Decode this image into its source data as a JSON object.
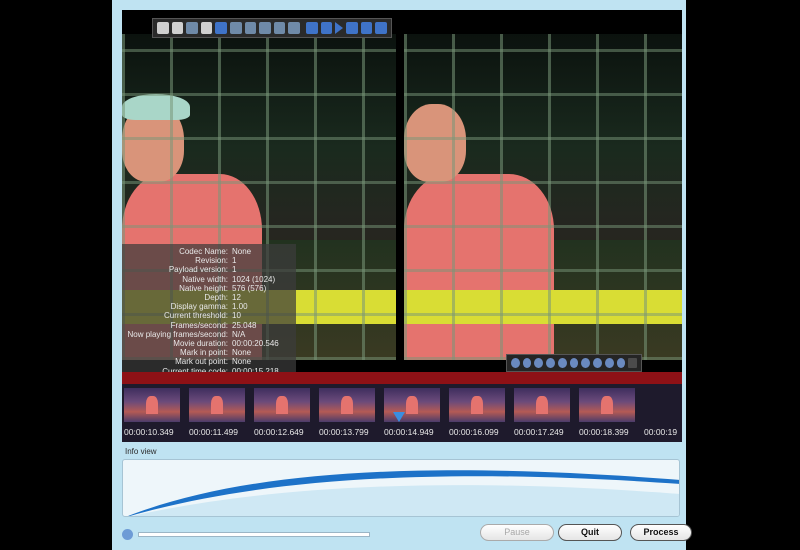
{
  "colors": {
    "window_bg": "#bfe3f2",
    "timeline_red": "#8e1116",
    "playhead": "#3a8ee0",
    "net_yellow_bar": "#d9dd34"
  },
  "player_toolbar": {
    "icons": [
      "folder-icon",
      "frame-icon",
      "split-icon",
      "compare-icon",
      "refresh-icon",
      "zoom-in-icon",
      "zoom-out-icon",
      "move-icon",
      "fit-icon",
      "monitor-icon",
      "skip-start-icon",
      "step-back-icon",
      "play-icon",
      "stop-icon",
      "step-forward-icon",
      "skip-end-icon"
    ]
  },
  "info_overlay": {
    "rows": [
      {
        "label": "Codec Name:",
        "value": "None"
      },
      {
        "label": "Revision:",
        "value": "1"
      },
      {
        "label": "Payload version:",
        "value": "1"
      },
      {
        "label": "Native width:",
        "value": "1024 (1024)"
      },
      {
        "label": "Native height:",
        "value": "576 (576)"
      },
      {
        "label": "Depth:",
        "value": "12"
      },
      {
        "label": "Display gamma:",
        "value": "1.00"
      },
      {
        "label": "Current threshold:",
        "value": "10"
      },
      {
        "label": "Frames/second:",
        "value": "25.048"
      },
      {
        "label": "Now playing frames/second:",
        "value": "N/A"
      },
      {
        "label": "Movie duration:",
        "value": "00:00:20.546"
      },
      {
        "label": "Mark in point:",
        "value": "None"
      },
      {
        "label": "Mark out point:",
        "value": "None"
      },
      {
        "label": "Current time code:",
        "value": "00:00:15.218"
      }
    ]
  },
  "zoom_toolbar": {
    "icons": [
      "zoom-in-icon",
      "zoom-out-icon",
      "zoom-fit-icon",
      "zoom-actual-icon",
      "zoom-100-icon",
      "zoom-region-icon",
      "arrow-left-icon",
      "arrow-right-icon",
      "plus-icon",
      "minus-icon",
      "trash-icon"
    ]
  },
  "timeline": {
    "timecodes": [
      "00:00:10.349",
      "00:00:11.499",
      "00:00:12.649",
      "00:00:13.799",
      "00:00:14.949",
      "00:00:16.099",
      "00:00:17.249",
      "00:00:18.399",
      "00:00:19"
    ]
  },
  "info_view": {
    "label": "Info view"
  },
  "bottom": {
    "progress_percent": 0,
    "pause_label": "Pause",
    "quit_label": "Quit",
    "process_label": "Process"
  }
}
